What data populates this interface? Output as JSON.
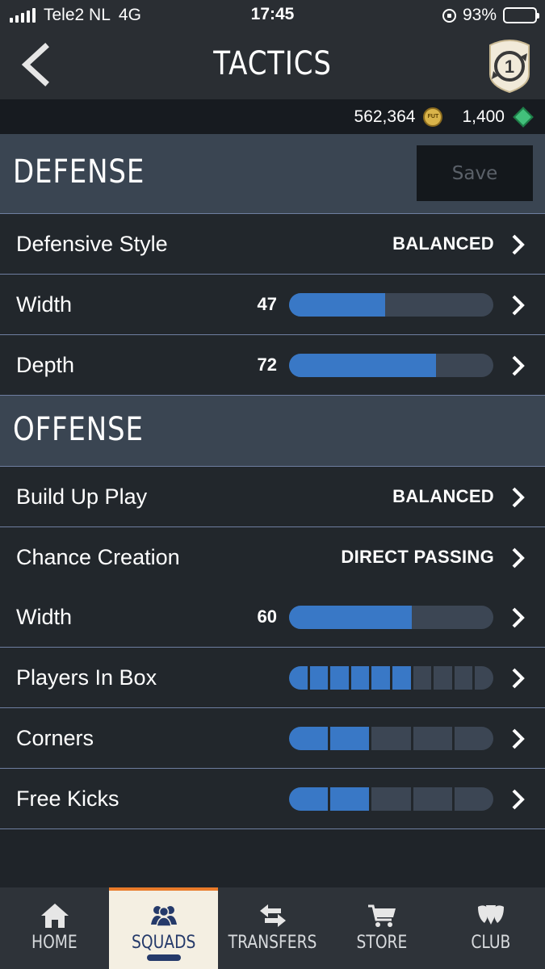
{
  "status_bar": {
    "carrier": "Tele2 NL",
    "network": "4G",
    "time": "17:45",
    "battery": "93%"
  },
  "header": {
    "title": "TACTICS",
    "badge_number": "1"
  },
  "currency": {
    "coins": "562,364",
    "coin_icon_text": "FUT",
    "points": "1,400"
  },
  "defense": {
    "title": "DEFENSE",
    "save_label": "Save",
    "rows": [
      {
        "label": "Defensive Style",
        "value": "BALANCED"
      },
      {
        "label": "Width",
        "number": "47",
        "fraction": 0.47
      },
      {
        "label": "Depth",
        "number": "72",
        "fraction": 0.72
      }
    ]
  },
  "offense": {
    "title": "OFFENSE",
    "rows": [
      {
        "label": "Build Up Play",
        "value": "BALANCED"
      },
      {
        "label": "Chance Creation",
        "value": "DIRECT PASSING"
      },
      {
        "label": "Width",
        "number": "60",
        "fraction": 0.6
      },
      {
        "label": "Players In Box",
        "segments_on": 6,
        "segments_total": 10
      },
      {
        "label": "Corners",
        "segments_on": 2,
        "segments_total": 5
      },
      {
        "label": "Free Kicks",
        "segments_on": 2,
        "segments_total": 5
      }
    ]
  },
  "nav": {
    "items": [
      {
        "label": "HOME",
        "icon": "home-icon"
      },
      {
        "label": "SQUADS",
        "icon": "squads-icon",
        "active": true
      },
      {
        "label": "TRANSFERS",
        "icon": "transfers-icon"
      },
      {
        "label": "STORE",
        "icon": "store-icon"
      },
      {
        "label": "CLUB",
        "icon": "club-icon"
      }
    ]
  },
  "colors": {
    "accent_blue": "#3978c6",
    "nav_active_bar": "#e97b2a",
    "section_header": "#3a4552"
  }
}
